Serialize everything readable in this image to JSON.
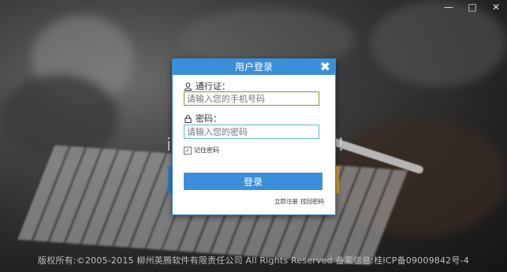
{
  "window_controls": {
    "minimize": "—",
    "maximize": "□",
    "close": "✕"
  },
  "background": {
    "partial_text_left": "i",
    "partial_text_right": "!"
  },
  "dialog": {
    "title": "用户登录",
    "close_glyph": "✖",
    "account_label": "通行证：",
    "account_placeholder": "请输入您的手机号码",
    "password_label": "密码：",
    "password_placeholder": "请输入您的密码",
    "remember_label": "记住密码",
    "remember_checked": true,
    "login_button": "登录",
    "register_link": "立即注册",
    "forgot_link": "找回密码",
    "icons": {
      "account": "user-icon",
      "password": "lock-icon"
    },
    "accent_color": "#3b8fd9"
  },
  "footer": {
    "text": "版权所有:©2005-2015   柳州英腾软件有限责任公司   All Rights Reserved   备案信息:桂ICP备09009842号-4"
  }
}
